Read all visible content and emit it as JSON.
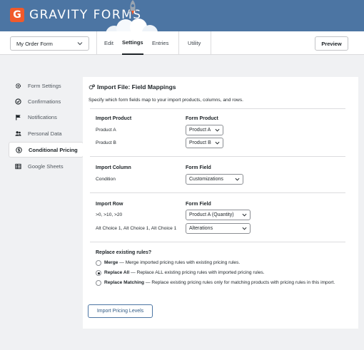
{
  "brand": {
    "name": "GRAVITY FORMS",
    "logo_letter": "G",
    "accent": "#f15a2b",
    "header_bg": "#4c75a3"
  },
  "nav": {
    "form_select": "My Order Form",
    "tabs": [
      {
        "label": "Edit"
      },
      {
        "label": "Settings"
      },
      {
        "label": "Entries"
      },
      {
        "label": "Utility"
      }
    ],
    "preview_label": "Preview"
  },
  "sidebar": {
    "items": [
      {
        "label": "Form Settings",
        "icon": "gear-icon"
      },
      {
        "label": "Confirmations",
        "icon": "check-circle-icon"
      },
      {
        "label": "Notifications",
        "icon": "flag-icon"
      },
      {
        "label": "Personal Data",
        "icon": "users-icon"
      },
      {
        "label": "Conditional Pricing",
        "icon": "dollar-circle-icon"
      },
      {
        "label": "Google Sheets",
        "icon": "grid-icon"
      }
    ]
  },
  "panel": {
    "title": "Import File: Field Mappings",
    "description": "Specify which form fields map to your import products, columns, and rows.",
    "product_section": {
      "header_left": "Import Product",
      "header_right": "Form Product",
      "rows": [
        {
          "label": "Product A",
          "value": "Product A"
        },
        {
          "label": "Product B",
          "value": "Product B"
        }
      ]
    },
    "column_section": {
      "header_left": "Import Column",
      "header_right": "Form Field",
      "rows": [
        {
          "label": "Condition",
          "value": "Customizations"
        }
      ]
    },
    "row_section": {
      "header_left": "Import Row",
      "header_right": "Form Field",
      "rows": [
        {
          "label": ">0, >10, >20",
          "value": "Product A (Quantity)"
        },
        {
          "label": "Alt Choice 1, Alt Choice 1, Alt Choice 1",
          "value": "Alterations"
        }
      ]
    },
    "replace": {
      "title": "Replace existing rules?",
      "options": [
        {
          "name": "Merge",
          "desc": "— Merge imported pricing rules with existing pricing rules.",
          "selected": false
        },
        {
          "name": "Replace All",
          "desc": "— Replace ALL existing pricing rules with imported pricing rules.",
          "selected": true
        },
        {
          "name": "Replace Matching",
          "desc": "— Replace existing pricing rules only for matching products with pricing rules in this import.",
          "selected": false
        }
      ]
    },
    "import_button": "Import Pricing Levels"
  }
}
